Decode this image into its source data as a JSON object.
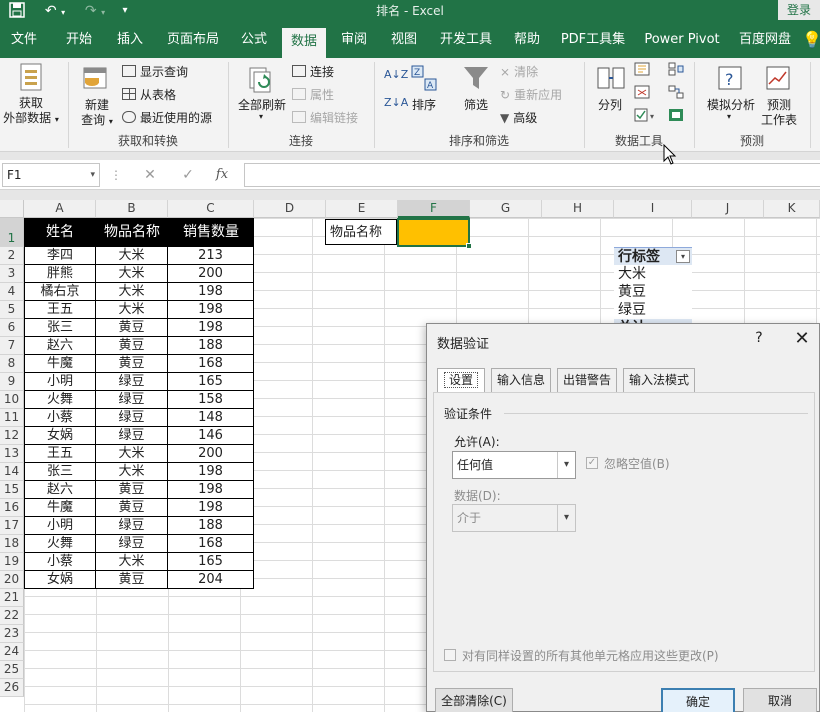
{
  "app": {
    "window_title": "排名 - Excel",
    "login_label": "登录"
  },
  "quick_access": {
    "save_icon": "save-icon",
    "undo_icon": "undo-icon",
    "redo_icon": "redo-icon",
    "customize_icon": "customize-icon"
  },
  "ribbon_tabs": [
    "文件",
    "开始",
    "插入",
    "页面布局",
    "公式",
    "数据",
    "审阅",
    "视图",
    "开发工具",
    "帮助",
    "PDF工具集",
    "Power Pivot",
    "百度网盘"
  ],
  "active_tab": "数据",
  "ribbon": {
    "get_data": {
      "line1": "获取",
      "line2": "外部数据"
    },
    "new_query": {
      "line1": "新建",
      "line2": "查询"
    },
    "show_query": "显示查询",
    "from_table": "从表格",
    "recent_sources": "最近使用的源",
    "group_get_transform": "获取和转换",
    "refresh_all": "全部刷新",
    "connections": "连接",
    "properties": "属性",
    "edit_links": "编辑链接",
    "group_connections": "连接",
    "sort_az": "A↓Z",
    "sort_za": "Z↓A",
    "sort": "排序",
    "filter": "筛选",
    "clear": "清除",
    "reapply": "重新应用",
    "advanced": "高级",
    "group_sort_filter": "排序和筛选",
    "text_to_columns": "分列",
    "group_data_tools": "数据工具",
    "what_if": "模拟分析",
    "forecast_sheet": {
      "line1": "预测",
      "line2": "工作表"
    },
    "group_forecast": "预测"
  },
  "formula_bar": {
    "name_box": "F1",
    "cancel": "✕",
    "enter": "✓",
    "fx": "fx",
    "value": ""
  },
  "columns": [
    "A",
    "B",
    "C",
    "D",
    "E",
    "F",
    "G",
    "H",
    "I",
    "J",
    "K"
  ],
  "selected_column": "F",
  "rows": [
    "1",
    "2",
    "3",
    "4",
    "5",
    "6",
    "7",
    "8",
    "9",
    "10",
    "11",
    "12",
    "13",
    "14",
    "15",
    "16",
    "17",
    "18",
    "19",
    "20",
    "21",
    "22",
    "23",
    "24",
    "25",
    "26"
  ],
  "table": {
    "headers": [
      "姓名",
      "物品名称",
      "销售数量"
    ],
    "rows": [
      [
        "李四",
        "大米",
        "213"
      ],
      [
        "胖熊",
        "大米",
        "200"
      ],
      [
        "橘右京",
        "大米",
        "198"
      ],
      [
        "王五",
        "大米",
        "198"
      ],
      [
        "张三",
        "黄豆",
        "198"
      ],
      [
        "赵六",
        "黄豆",
        "188"
      ],
      [
        "牛魔",
        "黄豆",
        "168"
      ],
      [
        "小明",
        "绿豆",
        "165"
      ],
      [
        "火舞",
        "绿豆",
        "158"
      ],
      [
        "小蔡",
        "绿豆",
        "148"
      ],
      [
        "女娲",
        "绿豆",
        "146"
      ],
      [
        "王五",
        "大米",
        "200"
      ],
      [
        "张三",
        "大米",
        "198"
      ],
      [
        "赵六",
        "黄豆",
        "198"
      ],
      [
        "牛魔",
        "黄豆",
        "198"
      ],
      [
        "小明",
        "绿豆",
        "188"
      ],
      [
        "火舞",
        "绿豆",
        "168"
      ],
      [
        "小蔡",
        "大米",
        "165"
      ],
      [
        "女娲",
        "黄豆",
        "204"
      ]
    ]
  },
  "e1_label": "物品名称",
  "f1_fill_color": "#ffc000",
  "pivot": {
    "header": "行标签",
    "items": [
      "大米",
      "黄豆",
      "绿豆",
      "总计"
    ]
  },
  "dialog": {
    "title": "数据验证",
    "help": "?",
    "close": "✕",
    "tabs": [
      "设置",
      "输入信息",
      "出错警告",
      "输入法模式"
    ],
    "active_tab": "设置",
    "section": "验证条件",
    "allow_label": "允许(A):",
    "allow_value": "任何值",
    "ignore_blank_label": "忽略空值(B)",
    "ignore_blank_checked": true,
    "data_label": "数据(D):",
    "data_value": "介于",
    "apply_all_label": "对有同样设置的所有其他单元格应用这些更改(P)",
    "apply_all_checked": false,
    "clear_all": "全部清除(C)",
    "ok": "确定",
    "cancel": "取消"
  },
  "colors": {
    "excel_green": "#217346",
    "selection_fill": "#ffc000",
    "table_header_bg": "#000000",
    "ok_border": "#3c7fb1"
  }
}
